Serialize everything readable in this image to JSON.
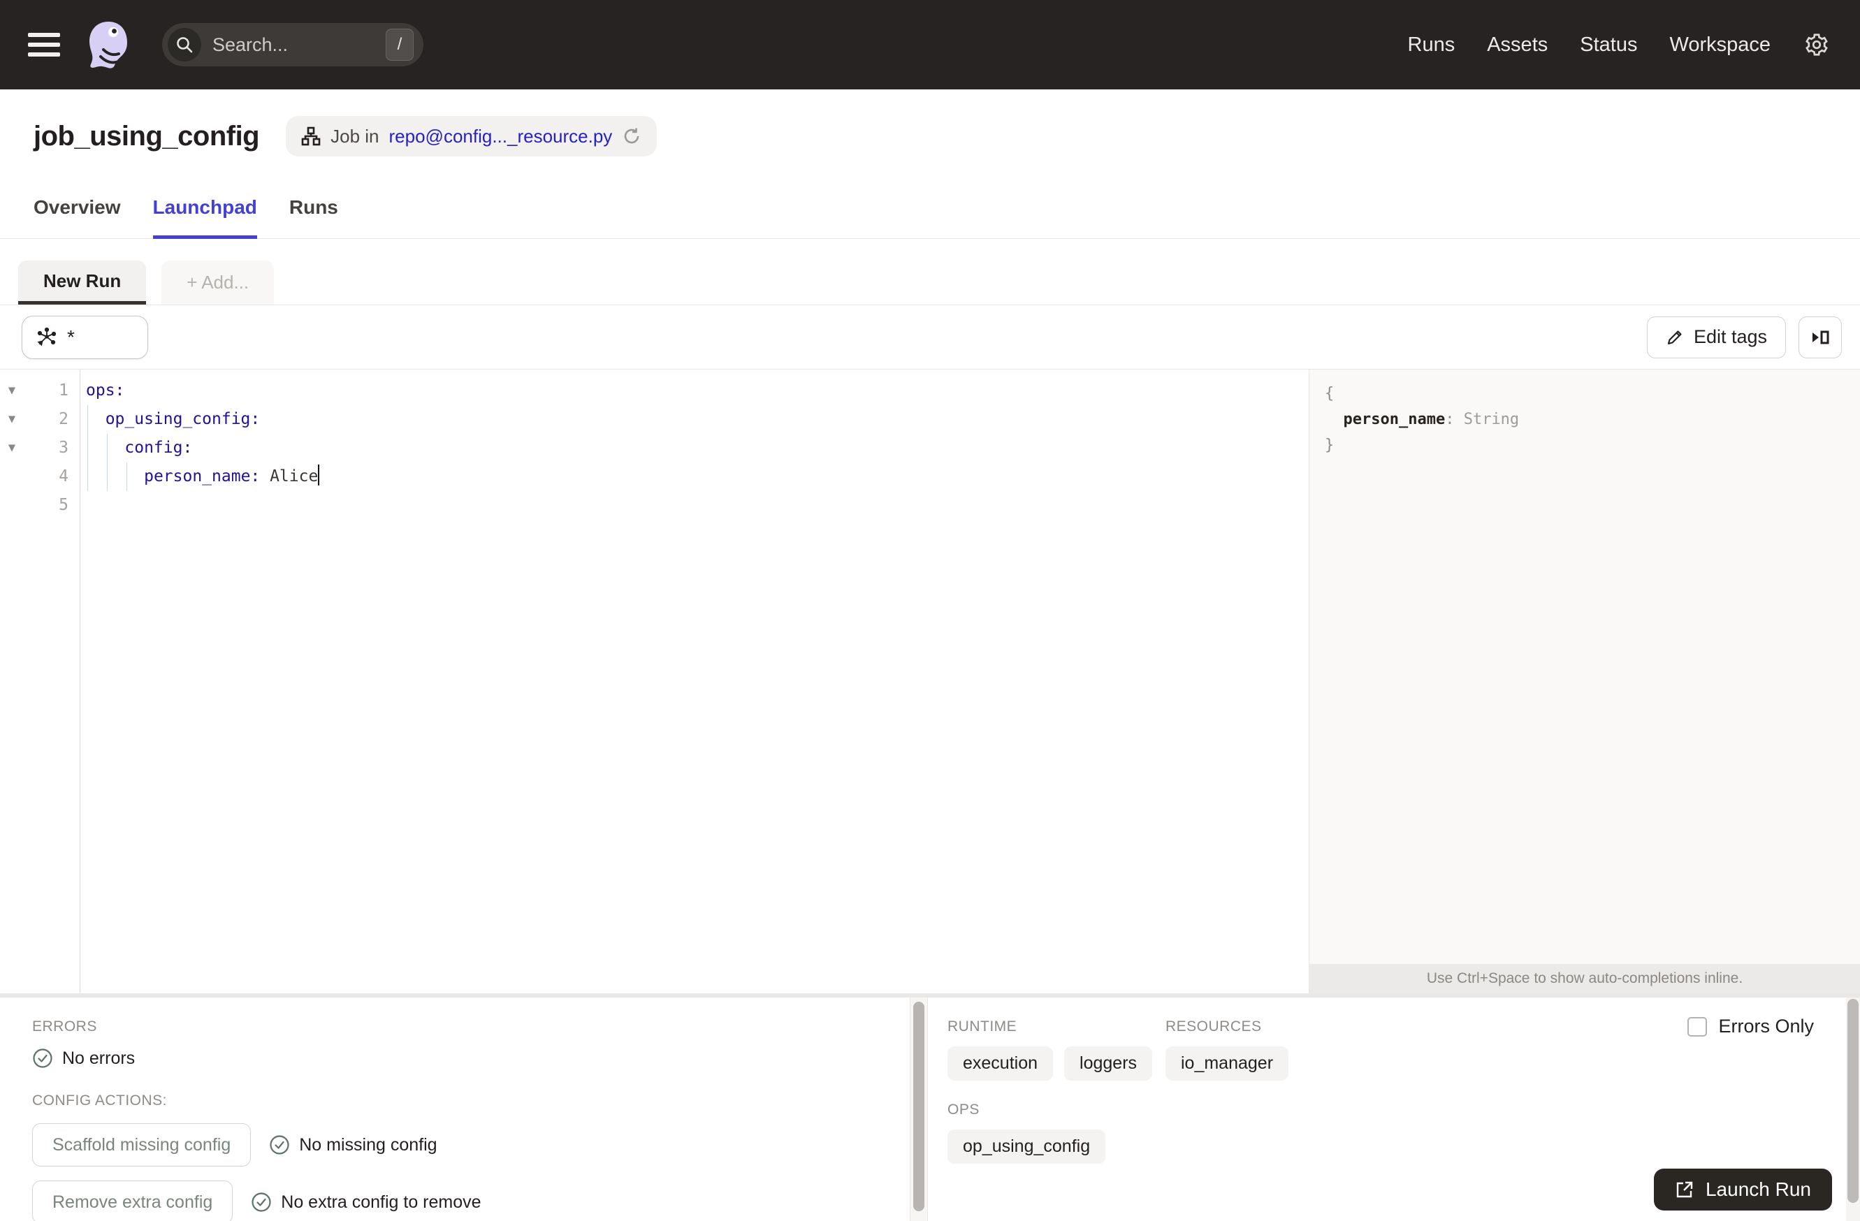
{
  "topnav": {
    "search_placeholder": "Search...",
    "search_shortcut": "/",
    "links": [
      {
        "label": "Runs"
      },
      {
        "label": "Assets"
      },
      {
        "label": "Status"
      },
      {
        "label": "Workspace"
      }
    ]
  },
  "header": {
    "title": "job_using_config",
    "badge": {
      "prefix": "Job in",
      "link": "repo@config..._resource.py"
    }
  },
  "tabs": [
    {
      "label": "Overview"
    },
    {
      "label": "Launchpad"
    },
    {
      "label": "Runs"
    }
  ],
  "run_tabs": {
    "active": "New Run",
    "add": "+ Add..."
  },
  "toolbar": {
    "op_selector": "*",
    "edit_tags": "Edit tags"
  },
  "editor": {
    "lines": [
      {
        "num": "1",
        "key": "ops:"
      },
      {
        "num": "2",
        "key": "op_using_config:"
      },
      {
        "num": "3",
        "key": "config:"
      },
      {
        "num": "4",
        "key": "person_name:",
        "value": "Alice"
      },
      {
        "num": "5"
      }
    ]
  },
  "schema": {
    "open_brace": "{",
    "field": "person_name",
    "colon": ": ",
    "type": "String",
    "close_brace": "}",
    "hint": "Use Ctrl+Space to show auto-completions inline."
  },
  "bottom": {
    "errors": {
      "label": "ERRORS",
      "status": "No errors"
    },
    "config_actions": {
      "label": "CONFIG ACTIONS:",
      "actions": [
        {
          "button": "Scaffold missing config",
          "status": "No missing config"
        },
        {
          "button": "Remove extra config",
          "status": "No extra config to remove"
        }
      ]
    },
    "runtime": {
      "label": "RUNTIME",
      "tags": [
        "execution",
        "loggers"
      ]
    },
    "resources": {
      "label": "RESOURCES",
      "tags": [
        "io_manager"
      ]
    },
    "ops": {
      "label": "OPS",
      "tags": [
        "op_using_config"
      ]
    },
    "errors_only": "Errors Only",
    "launch": "Launch Run"
  },
  "colors": {
    "nav_bg": "#262322",
    "accent": "#4440D4",
    "link": "#251FC4",
    "code_key": "#221199",
    "logo_lavender": "#D8D0F4"
  }
}
